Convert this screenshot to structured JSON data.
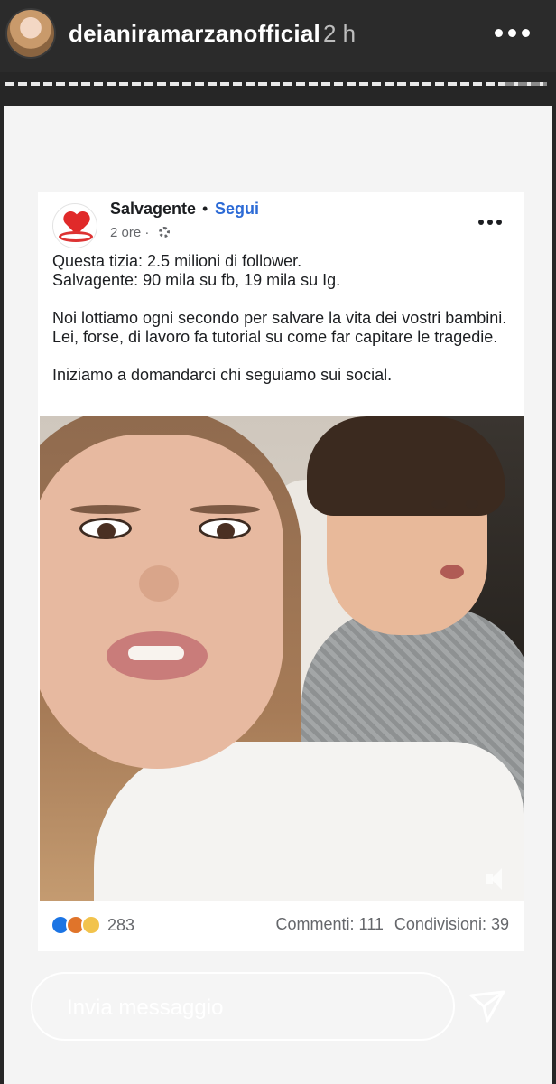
{
  "header": {
    "username": "deianiramarzanofficial",
    "time_ago": "2 h"
  },
  "post": {
    "page_name": "Salvagente",
    "separator": "•",
    "follow_label": "Segui",
    "time_label": "2 ore ·",
    "text_lines": [
      "Questa tizia: 2.5 milioni di follower.",
      "Salvagente: 90 mila su fb, 19 mila su Ig.",
      "Noi lottiamo ogni secondo per salvare la vita dei vostri bambini. Lei, forse, di lavoro fa tutorial su come far capitare le tragedie.",
      "Iniziamo a domandarci chi seguiamo sui social."
    ],
    "reaction_count": "283",
    "comments_label": "Commenti: 111",
    "shares_label": "Condivisioni: 39"
  },
  "message_bar": {
    "placeholder": "Invia messaggio"
  },
  "colors": {
    "background": "#262626",
    "follow_blue": "#2d6bd6",
    "like_blue": "#1b74e4"
  },
  "icons": {
    "avatar": "profile-photo",
    "more": "three-dots-icon",
    "post_more": "three-dots-icon",
    "privacy": "gear-icon",
    "sound": "speaker-icon",
    "send": "paper-plane-icon"
  }
}
